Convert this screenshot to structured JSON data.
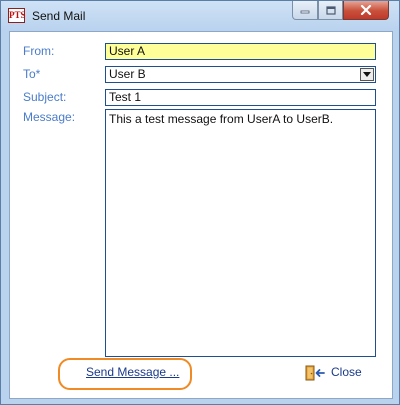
{
  "window": {
    "title": "Send Mail",
    "app_icon_text": "PTS"
  },
  "form": {
    "from_label": "From:",
    "from_value": "User A",
    "to_label": "To*",
    "to_value": "User B",
    "subject_label": "Subject:",
    "subject_value": "Test 1",
    "message_label": "Message:",
    "message_value": "This a test message from UserA to UserB."
  },
  "actions": {
    "send_label": "Send Message ...",
    "close_label": "Close"
  },
  "colors": {
    "from_field_bg": "#ffff99",
    "label_color": "#4a7cc9",
    "highlight_ring": "#f08a24"
  }
}
